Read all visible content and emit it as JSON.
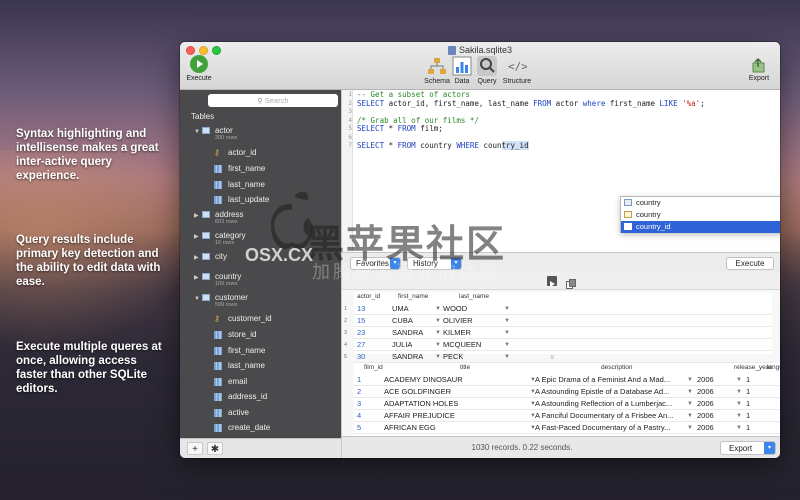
{
  "promo": [
    "Syntax highlighting and intellisense makes a great inter-active query experience.",
    "Query results include primary key detection and the ability to edit data with ease.",
    "Execute multiple queres at once, allowing access faster than other SQLite editors."
  ],
  "window": {
    "title": "Sakila.sqlite3",
    "toolbar": {
      "execute": "Execute",
      "schema": "Schema",
      "data": "Data",
      "query": "Query",
      "structure": "Structure",
      "export": "Export"
    }
  },
  "sidebar": {
    "search_placeholder": "Search",
    "tables_header": "Tables",
    "items": [
      {
        "label": "actor",
        "sub": "200 rows",
        "kind": "table",
        "expanded": true
      },
      {
        "label": "actor_id",
        "kind": "key"
      },
      {
        "label": "first_name",
        "kind": "column"
      },
      {
        "label": "last_name",
        "kind": "column"
      },
      {
        "label": "last_update",
        "kind": "column"
      },
      {
        "label": "address",
        "sub": "603 rows",
        "kind": "table"
      },
      {
        "label": "category",
        "sub": "16 rows",
        "kind": "table"
      },
      {
        "label": "city",
        "sub": "",
        "kind": "table"
      },
      {
        "label": "country",
        "sub": "109 rows",
        "kind": "table"
      },
      {
        "label": "customer",
        "sub": "599 rows",
        "kind": "table",
        "expanded": true
      },
      {
        "label": "customer_id",
        "kind": "key"
      },
      {
        "label": "store_id",
        "kind": "column"
      },
      {
        "label": "first_name",
        "kind": "column"
      },
      {
        "label": "last_name",
        "kind": "column"
      },
      {
        "label": "email",
        "kind": "column"
      },
      {
        "label": "address_id",
        "kind": "column"
      },
      {
        "label": "active",
        "kind": "column"
      },
      {
        "label": "create_date",
        "kind": "column"
      }
    ],
    "add_label": "+",
    "gear_label": "✱"
  },
  "editor": {
    "line_numbers": [
      "1",
      "2",
      "3",
      "4",
      "5",
      "6",
      "7"
    ],
    "lines": [
      {
        "parts": [
          {
            "t": "-- Get a subset of actors",
            "c": "cm"
          }
        ]
      },
      {
        "parts": [
          {
            "t": "SELECT",
            "c": "kw"
          },
          {
            "t": " actor_id, first_name, last_name ",
            "c": ""
          },
          {
            "t": "FROM",
            "c": "kw"
          },
          {
            "t": " actor ",
            "c": ""
          },
          {
            "t": "where",
            "c": "kw"
          },
          {
            "t": " first_name ",
            "c": ""
          },
          {
            "t": "LIKE",
            "c": "kw"
          },
          {
            "t": " ",
            "c": ""
          },
          {
            "t": "'%a'",
            "c": "str"
          },
          {
            "t": ";",
            "c": ""
          }
        ]
      },
      {
        "parts": []
      },
      {
        "parts": [
          {
            "t": "/* Grab all of our films */",
            "c": "cm"
          }
        ]
      },
      {
        "parts": [
          {
            "t": "SELECT",
            "c": "kw"
          },
          {
            "t": " * ",
            "c": ""
          },
          {
            "t": "FROM",
            "c": "kw"
          },
          {
            "t": " film;",
            "c": ""
          }
        ]
      },
      {
        "parts": []
      },
      {
        "parts": [
          {
            "t": "SELECT",
            "c": "kw"
          },
          {
            "t": " * ",
            "c": ""
          },
          {
            "t": "FROM",
            "c": "kw"
          },
          {
            "t": " country ",
            "c": ""
          },
          {
            "t": "WHERE",
            "c": "kw"
          },
          {
            "t": " coun",
            "c": ""
          },
          {
            "t": "try_id",
            "c": "sel"
          }
        ]
      }
    ],
    "autocomplete": [
      {
        "label": "country",
        "active": false
      },
      {
        "label": "country",
        "active": false
      },
      {
        "label": "country_id",
        "active": true
      }
    ]
  },
  "query_bar": {
    "favorites": "Favorites",
    "history": "History",
    "execute": "Execute"
  },
  "result1": {
    "columns": [
      "actor_id",
      "first_name",
      "last_name"
    ],
    "rows": [
      {
        "n": "1",
        "id": "13",
        "first": "UMA",
        "last": "WOOD"
      },
      {
        "n": "2",
        "id": "15",
        "first": "CUBA",
        "last": "OLIVIER"
      },
      {
        "n": "3",
        "id": "23",
        "first": "SANDRA",
        "last": "KILMER"
      },
      {
        "n": "4",
        "id": "27",
        "first": "JULIA",
        "last": "MCQUEEN"
      },
      {
        "n": "5",
        "id": "30",
        "first": "SANDRA",
        "last": "PECK"
      }
    ]
  },
  "result2": {
    "columns": [
      "film_id",
      "title",
      "description",
      "release_year",
      "langu"
    ],
    "rows": [
      {
        "n": "1",
        "id": "1",
        "title": "ACADEMY DINOSAUR",
        "desc": "A Epic Drama of a Feminist And a Mad...",
        "year": "2006",
        "lang": "1"
      },
      {
        "n": "2",
        "id": "2",
        "title": "ACE GOLDFINGER",
        "desc": "A Astounding Epistle of a Database Ad...",
        "year": "2006",
        "lang": "1"
      },
      {
        "n": "3",
        "id": "3",
        "title": "ADAPTATION HOLES",
        "desc": "A Astounding Reflection of a Lumberjac...",
        "year": "2006",
        "lang": "1"
      },
      {
        "n": "4",
        "id": "4",
        "title": "AFFAIR PREJUDICE",
        "desc": "A Fanciful Documentary of a Frisbee An...",
        "year": "2006",
        "lang": "1"
      },
      {
        "n": "5",
        "id": "5",
        "title": "AFRICAN EGG",
        "desc": "A Fast-Paced Documentary of a Pastry...",
        "year": "2006",
        "lang": "1"
      }
    ]
  },
  "status": {
    "text": "1030 records. 0.22 seconds.",
    "export": "Export"
  },
  "watermark": {
    "cn_title": "黑苹果社区",
    "domain": "OSX.CX",
    "cn_sub": "加腾只为更好的体验"
  },
  "colors": {
    "accent": "#3b86e8",
    "selection": "#2f63d8",
    "keyword": "#1a3fc0",
    "comment": "#2a8a2a",
    "string": "#c02020",
    "sidebar_bg": "#4a4a4c"
  }
}
